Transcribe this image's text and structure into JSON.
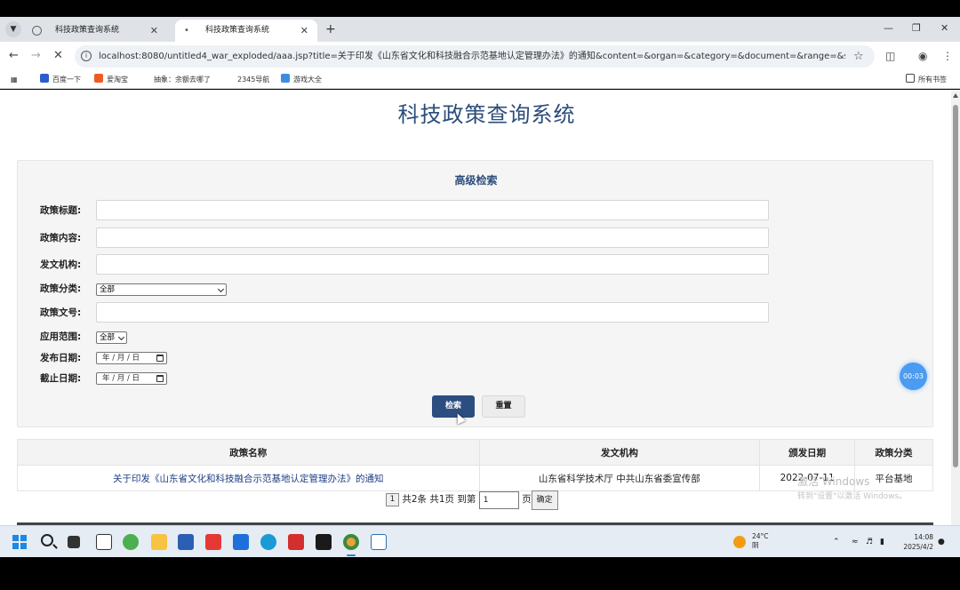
{
  "browser": {
    "tabs": [
      {
        "label": "科技政策查询系统",
        "active": false
      },
      {
        "label": "科技政策查询系统",
        "active": true
      }
    ],
    "new_tab": "+",
    "url": "localhost:8080/untitled4_war_exploded/aaa.jsp?title=关于印发《山东省文化和科技融合示范基地认定管理办法》的通知&content=&organ=&category=&document=&range=&start...",
    "bookmarks": [
      "百度一下",
      "爱淘宝",
      "抽象：余额去哪了",
      "2345导航",
      "游戏大全"
    ],
    "all_bookmarks": "所有书签"
  },
  "page": {
    "site_title": "科技政策查询系统",
    "panel_title": "高级检索",
    "fields": {
      "title_label": "政策标题:",
      "content_label": "政策内容:",
      "organ_label": "发文机构:",
      "category_label": "政策分类:",
      "category_value": "全部",
      "document_label": "政策文号:",
      "range_label": "应用范围:",
      "range_value": "全部",
      "start_label": "发布日期:",
      "start_placeholder": "年 / 月 / 日",
      "end_label": "截止日期:",
      "end_placeholder": "年 / 月 / 日"
    },
    "search_button": "检索",
    "reset_button": "重置",
    "table": {
      "headers": [
        "政策名称",
        "发文机构",
        "颁发日期",
        "政策分类"
      ],
      "rows": [
        [
          "关于印发《山东省文化和科技融合示范基地认定管理办法》的通知",
          "山东省科学技术厅 中共山东省委宣传部",
          "2022-07-11",
          "平台基地"
        ]
      ]
    },
    "pager": {
      "current_page": "1",
      "summary": "共2条 共1页 到第",
      "goto_value": "1",
      "page_suffix": "页",
      "confirm": "确定"
    },
    "timer": "00:03",
    "watermark_title": "激活 Windows",
    "watermark_sub": "转到\"设置\"以激活 Windows。"
  },
  "taskbar": {
    "weather_temp": "24°C",
    "weather_desc": "阴",
    "time": "14:08",
    "date": "2025/4/2"
  },
  "colors": {
    "title": "#2c4d7a",
    "search_button": "#2c4d80",
    "link": "#1d3e82"
  }
}
